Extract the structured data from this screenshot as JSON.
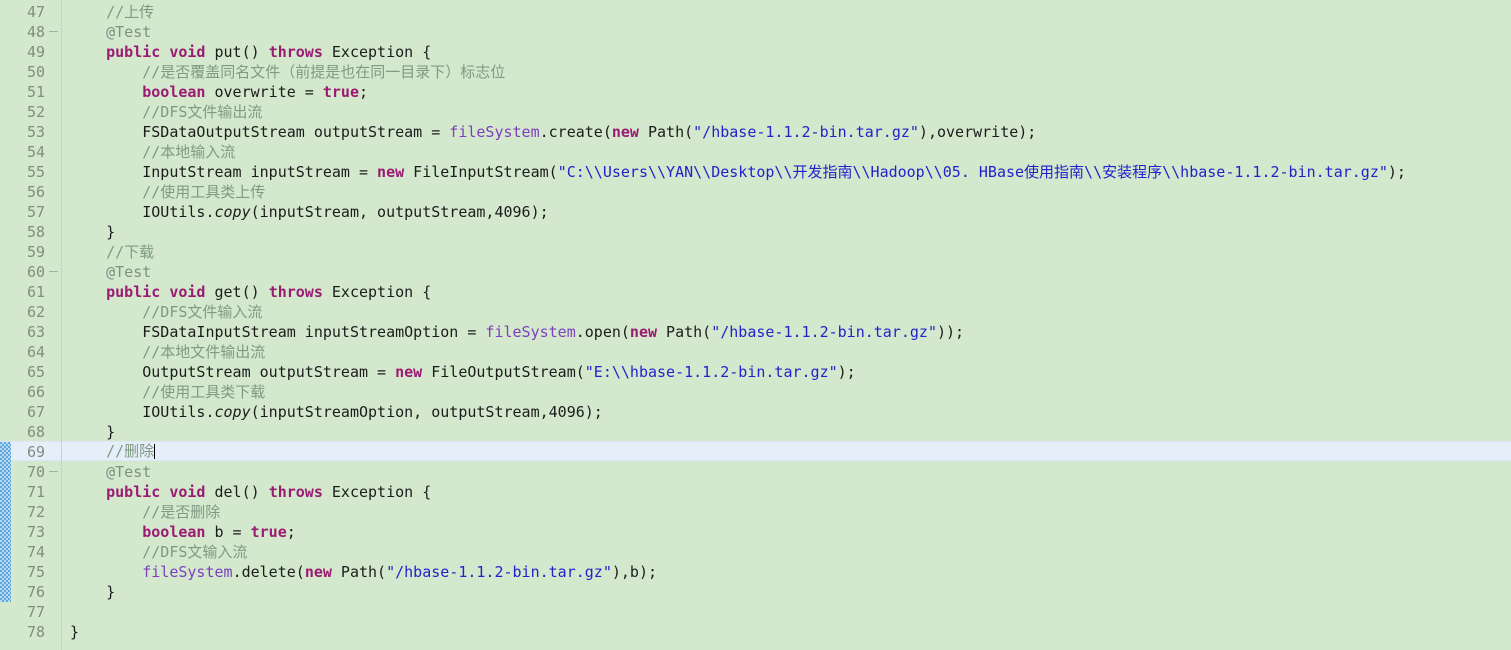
{
  "editor": {
    "background_color": "#d3e8cd",
    "current_line_color": "#e6eefa",
    "gutter_text_color": "#808e80",
    "first_visible_line": 47,
    "last_visible_line": 78,
    "current_line": 69,
    "change_marker_lines": "69-76",
    "language": "Java"
  },
  "lines": [
    {
      "n": "47",
      "fold": false,
      "tokens": [
        {
          "t": "cmt",
          "v": "    //上传"
        }
      ]
    },
    {
      "n": "48",
      "fold": true,
      "tokens": [
        {
          "t": "ann",
          "v": "    @Test"
        }
      ]
    },
    {
      "n": "49",
      "fold": false,
      "tokens": [
        {
          "t": "plain",
          "v": "    "
        },
        {
          "t": "kw",
          "v": "public"
        },
        {
          "t": "plain",
          "v": " "
        },
        {
          "t": "kw",
          "v": "void"
        },
        {
          "t": "plain",
          "v": " put() "
        },
        {
          "t": "kw",
          "v": "throws"
        },
        {
          "t": "plain",
          "v": " Exception {"
        }
      ]
    },
    {
      "n": "50",
      "fold": false,
      "tokens": [
        {
          "t": "cmt",
          "v": "        //是否覆盖同名文件（前提是也在同一目录下）标志位"
        }
      ]
    },
    {
      "n": "51",
      "fold": false,
      "tokens": [
        {
          "t": "plain",
          "v": "        "
        },
        {
          "t": "kw",
          "v": "boolean"
        },
        {
          "t": "plain",
          "v": " overwrite = "
        },
        {
          "t": "kw",
          "v": "true"
        },
        {
          "t": "plain",
          "v": ";"
        }
      ]
    },
    {
      "n": "52",
      "fold": false,
      "tokens": [
        {
          "t": "cmt",
          "v": "        //DFS文件输出流"
        }
      ]
    },
    {
      "n": "53",
      "fold": false,
      "tokens": [
        {
          "t": "plain",
          "v": "        FSDataOutputStream outputStream = "
        },
        {
          "t": "fld",
          "v": "fileSystem"
        },
        {
          "t": "plain",
          "v": ".create("
        },
        {
          "t": "kw",
          "v": "new"
        },
        {
          "t": "plain",
          "v": " Path("
        },
        {
          "t": "str",
          "v": "\"/hbase-1.1.2-bin.tar.gz\""
        },
        {
          "t": "plain",
          "v": "),overwrite);"
        }
      ]
    },
    {
      "n": "54",
      "fold": false,
      "tokens": [
        {
          "t": "cmt",
          "v": "        //本地输入流"
        }
      ]
    },
    {
      "n": "55",
      "fold": false,
      "tokens": [
        {
          "t": "plain",
          "v": "        InputStream inputStream = "
        },
        {
          "t": "kw",
          "v": "new"
        },
        {
          "t": "plain",
          "v": " FileInputStream("
        },
        {
          "t": "str",
          "v": "\"C:\\\\Users\\\\YAN\\\\Desktop\\\\开发指南\\\\Hadoop\\\\05. HBase使用指南\\\\安装程序\\\\hbase-1.1.2-bin.tar.gz\""
        },
        {
          "t": "plain",
          "v": ");"
        }
      ]
    },
    {
      "n": "56",
      "fold": false,
      "tokens": [
        {
          "t": "cmt",
          "v": "        //使用工具类上传"
        }
      ]
    },
    {
      "n": "57",
      "fold": false,
      "tokens": [
        {
          "t": "plain",
          "v": "        IOUtils."
        },
        {
          "t": "sttc",
          "v": "copy"
        },
        {
          "t": "plain",
          "v": "(inputStream, outputStream,4096);"
        }
      ]
    },
    {
      "n": "58",
      "fold": false,
      "tokens": [
        {
          "t": "plain",
          "v": "    }"
        }
      ]
    },
    {
      "n": "59",
      "fold": false,
      "tokens": [
        {
          "t": "cmt",
          "v": "    //下载"
        }
      ]
    },
    {
      "n": "60",
      "fold": true,
      "tokens": [
        {
          "t": "ann",
          "v": "    @Test"
        }
      ]
    },
    {
      "n": "61",
      "fold": false,
      "tokens": [
        {
          "t": "plain",
          "v": "    "
        },
        {
          "t": "kw",
          "v": "public"
        },
        {
          "t": "plain",
          "v": " "
        },
        {
          "t": "kw",
          "v": "void"
        },
        {
          "t": "plain",
          "v": " get() "
        },
        {
          "t": "kw",
          "v": "throws"
        },
        {
          "t": "plain",
          "v": " Exception {"
        }
      ]
    },
    {
      "n": "62",
      "fold": false,
      "tokens": [
        {
          "t": "cmt",
          "v": "        //DFS文件输入流"
        }
      ]
    },
    {
      "n": "63",
      "fold": false,
      "tokens": [
        {
          "t": "plain",
          "v": "        FSDataInputStream inputStreamOption = "
        },
        {
          "t": "fld",
          "v": "fileSystem"
        },
        {
          "t": "plain",
          "v": ".open("
        },
        {
          "t": "kw",
          "v": "new"
        },
        {
          "t": "plain",
          "v": " Path("
        },
        {
          "t": "str",
          "v": "\"/hbase-1.1.2-bin.tar.gz\""
        },
        {
          "t": "plain",
          "v": "));"
        }
      ]
    },
    {
      "n": "64",
      "fold": false,
      "tokens": [
        {
          "t": "cmt",
          "v": "        //本地文件输出流"
        }
      ]
    },
    {
      "n": "65",
      "fold": false,
      "tokens": [
        {
          "t": "plain",
          "v": "        OutputStream outputStream = "
        },
        {
          "t": "kw",
          "v": "new"
        },
        {
          "t": "plain",
          "v": " FileOutputStream("
        },
        {
          "t": "str",
          "v": "\"E:\\\\hbase-1.1.2-bin.tar.gz\""
        },
        {
          "t": "plain",
          "v": ");"
        }
      ]
    },
    {
      "n": "66",
      "fold": false,
      "tokens": [
        {
          "t": "cmt",
          "v": "        //使用工具类下载"
        }
      ]
    },
    {
      "n": "67",
      "fold": false,
      "tokens": [
        {
          "t": "plain",
          "v": "        IOUtils."
        },
        {
          "t": "sttc",
          "v": "copy"
        },
        {
          "t": "plain",
          "v": "(inputStreamOption, outputStream,4096);"
        }
      ]
    },
    {
      "n": "68",
      "fold": false,
      "tokens": [
        {
          "t": "plain",
          "v": "    }"
        }
      ]
    },
    {
      "n": "69",
      "fold": false,
      "current": true,
      "caret": true,
      "tokens": [
        {
          "t": "cmt",
          "v": "    //删除"
        }
      ]
    },
    {
      "n": "70",
      "fold": true,
      "tokens": [
        {
          "t": "ann",
          "v": "    @Test"
        }
      ]
    },
    {
      "n": "71",
      "fold": false,
      "tokens": [
        {
          "t": "plain",
          "v": "    "
        },
        {
          "t": "kw",
          "v": "public"
        },
        {
          "t": "plain",
          "v": " "
        },
        {
          "t": "kw",
          "v": "void"
        },
        {
          "t": "plain",
          "v": " del() "
        },
        {
          "t": "kw",
          "v": "throws"
        },
        {
          "t": "plain",
          "v": " Exception {"
        }
      ]
    },
    {
      "n": "72",
      "fold": false,
      "tokens": [
        {
          "t": "cmt",
          "v": "        //是否删除"
        }
      ]
    },
    {
      "n": "73",
      "fold": false,
      "tokens": [
        {
          "t": "plain",
          "v": "        "
        },
        {
          "t": "kw",
          "v": "boolean"
        },
        {
          "t": "plain",
          "v": " b = "
        },
        {
          "t": "kw",
          "v": "true"
        },
        {
          "t": "plain",
          "v": ";"
        }
      ]
    },
    {
      "n": "74",
      "fold": false,
      "tokens": [
        {
          "t": "cmt",
          "v": "        //DFS文输入流"
        }
      ]
    },
    {
      "n": "75",
      "fold": false,
      "tokens": [
        {
          "t": "plain",
          "v": "        "
        },
        {
          "t": "fld",
          "v": "fileSystem"
        },
        {
          "t": "plain",
          "v": ".delete("
        },
        {
          "t": "kw",
          "v": "new"
        },
        {
          "t": "plain",
          "v": " Path("
        },
        {
          "t": "str",
          "v": "\"/hbase-1.1.2-bin.tar.gz\""
        },
        {
          "t": "plain",
          "v": "),b);"
        }
      ]
    },
    {
      "n": "76",
      "fold": false,
      "tokens": [
        {
          "t": "plain",
          "v": "    }"
        }
      ]
    },
    {
      "n": "77",
      "fold": false,
      "tokens": [
        {
          "t": "plain",
          "v": ""
        }
      ]
    },
    {
      "n": "78",
      "fold": false,
      "tokens": [
        {
          "t": "plain",
          "v": "}"
        }
      ]
    }
  ]
}
